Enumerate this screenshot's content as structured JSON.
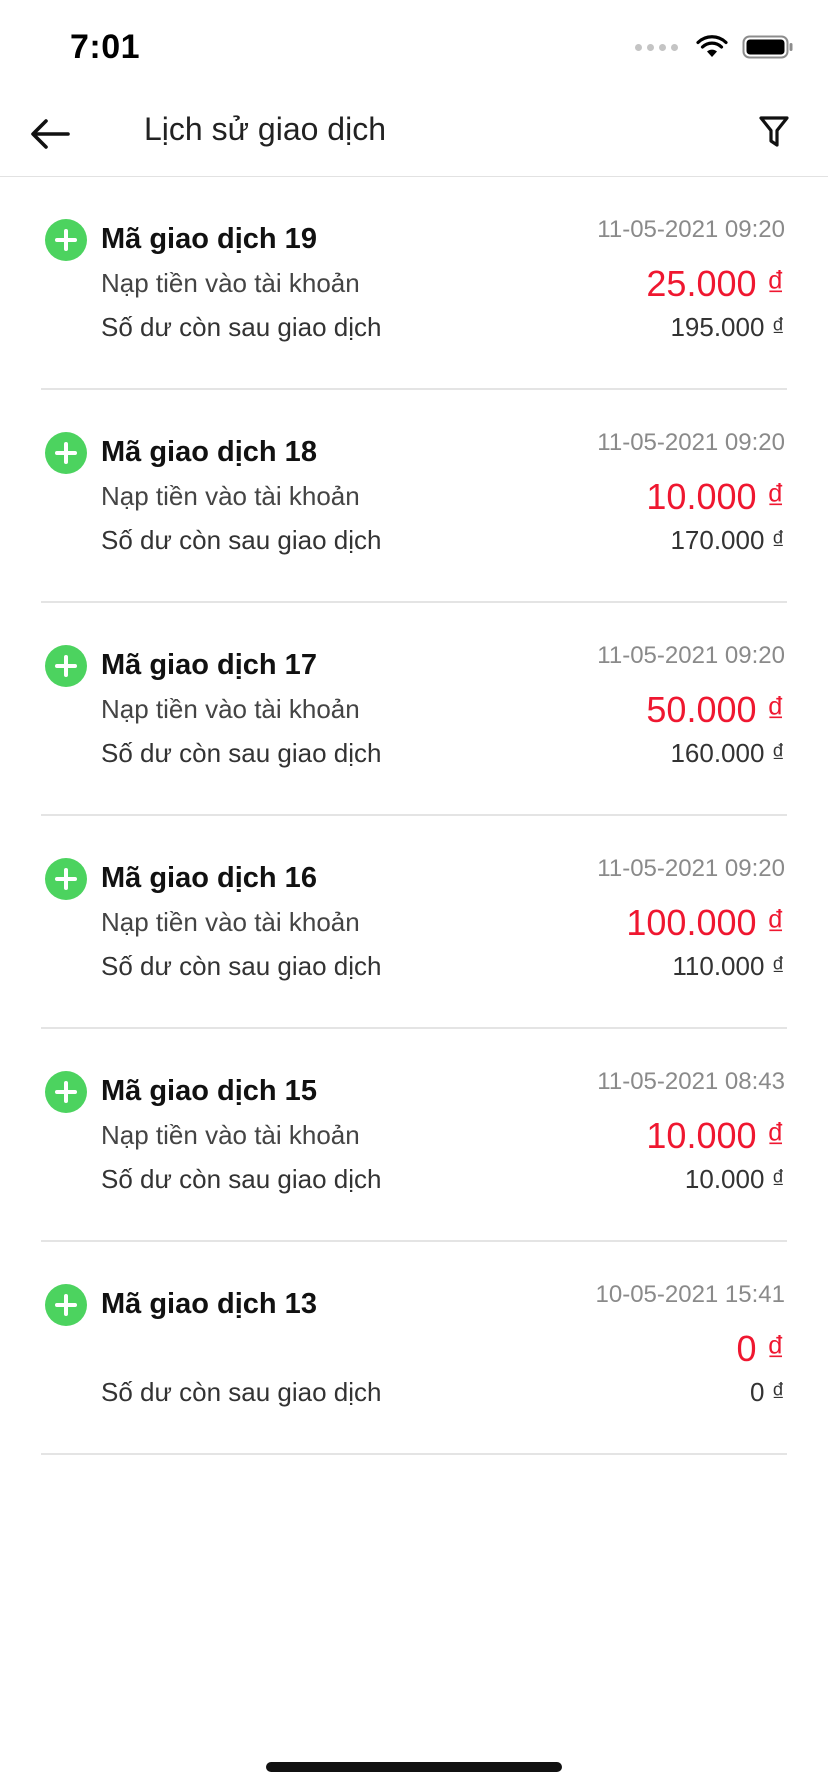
{
  "status_bar": {
    "time": "7:01",
    "icons": [
      "signal-icon",
      "wifi-icon",
      "battery-icon"
    ]
  },
  "header": {
    "title": "Lịch sử giao dịch",
    "back_icon": "arrow-left-icon",
    "filter_icon": "filter-icon"
  },
  "colors": {
    "amount": "#ef1730",
    "add_icon": "#4cd35f",
    "divider": "#e4e4e4"
  },
  "transactions": [
    {
      "title": "Mã giao dịch 19",
      "date": "11-05-2021 09:20",
      "description": "Nạp tiền vào tài khoản",
      "amount": "25.000 ₫",
      "balance_label": "Số dư còn sau giao dịch",
      "balance": "195.000 ₫"
    },
    {
      "title": "Mã giao dịch 18",
      "date": "11-05-2021 09:20",
      "description": "Nạp tiền vào tài khoản",
      "amount": "10.000 ₫",
      "balance_label": "Số dư còn sau giao dịch",
      "balance": "170.000 ₫"
    },
    {
      "title": "Mã giao dịch 17",
      "date": "11-05-2021 09:20",
      "description": "Nạp tiền vào tài khoản",
      "amount": "50.000 ₫",
      "balance_label": "Số dư còn sau giao dịch",
      "balance": "160.000 ₫"
    },
    {
      "title": "Mã giao dịch 16",
      "date": "11-05-2021 09:20",
      "description": "Nạp tiền vào tài khoản",
      "amount": "100.000 ₫",
      "balance_label": "Số dư còn sau giao dịch",
      "balance": "110.000 ₫"
    },
    {
      "title": "Mã giao dịch 15",
      "date": "11-05-2021 08:43",
      "description": "Nạp tiền vào tài khoản",
      "amount": "10.000 ₫",
      "balance_label": "Số dư còn sau giao dịch",
      "balance": "10.000 ₫"
    },
    {
      "title": "Mã giao dịch 13",
      "date": "10-05-2021 15:41",
      "description": "",
      "amount": "0 ₫",
      "balance_label": "Số dư còn sau giao dịch",
      "balance": "0 ₫"
    }
  ]
}
